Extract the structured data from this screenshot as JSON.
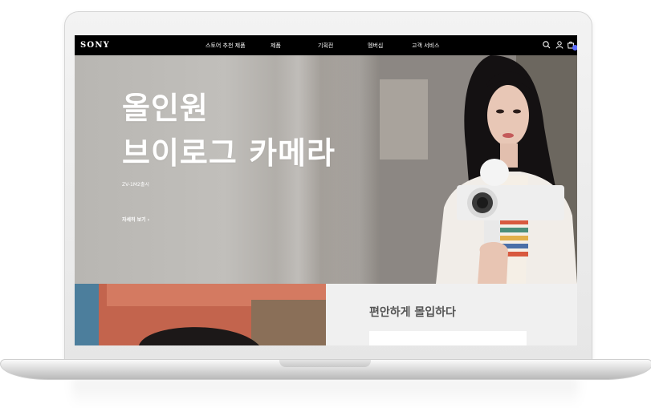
{
  "brand": {
    "logo": "SONY"
  },
  "nav": {
    "items": [
      {
        "label": "스토어 추천 제품"
      },
      {
        "label": "제품"
      },
      {
        "label": "기획전"
      },
      {
        "label": "멤버십"
      },
      {
        "label": "고객 서비스"
      }
    ],
    "icons": [
      "search-icon",
      "user-icon",
      "cart-icon"
    ]
  },
  "hero": {
    "title_line1": "올인원",
    "title_line2": "브이로그 카메라",
    "subtitle": "ZV-1M2출시",
    "cta": "자세히 보기 ›"
  },
  "promo": {
    "title": "편안하게 몰입하다"
  },
  "colors": {
    "nav_bg": "#000000",
    "accent": "#5b6cff",
    "hero_text": "#ffffff",
    "promo_bg": "#f0f0f0"
  }
}
